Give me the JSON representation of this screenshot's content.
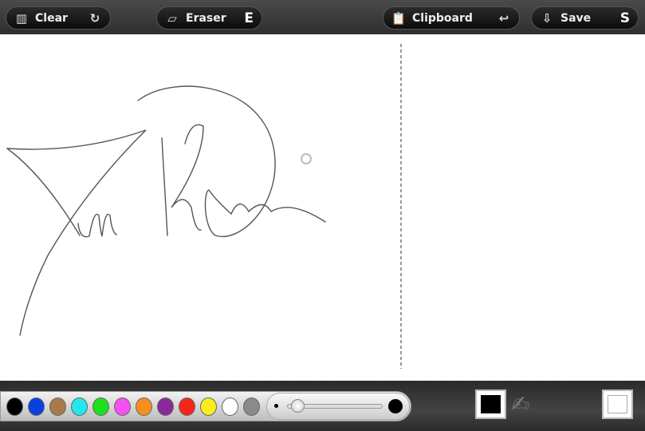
{
  "toolbar": {
    "clear": {
      "label": "Clear",
      "icon": "trash-icon",
      "shortcut_icon": "undo-circle-icon"
    },
    "eraser": {
      "label": "Eraser",
      "icon": "eraser-icon",
      "shortcut": "E"
    },
    "clipboard": {
      "label": "Clipboard",
      "icon": "clipboard-icon",
      "shortcut_icon": "return-arrow-icon"
    },
    "save": {
      "label": "Save",
      "icon": "save-download-icon",
      "shortcut": "S"
    }
  },
  "palette": {
    "colors": [
      "#000000",
      "#0a3fe0",
      "#a87a4a",
      "#22e8ee",
      "#1ee01e",
      "#f650f0",
      "#f5901e",
      "#8a2a9a",
      "#f2261a",
      "#f8ec1e",
      "#ffffff",
      "#8a8a8a"
    ]
  },
  "brush_size": {
    "value_fraction": 0.05
  },
  "current_color": "#000000",
  "background_color": "#ffffff"
}
